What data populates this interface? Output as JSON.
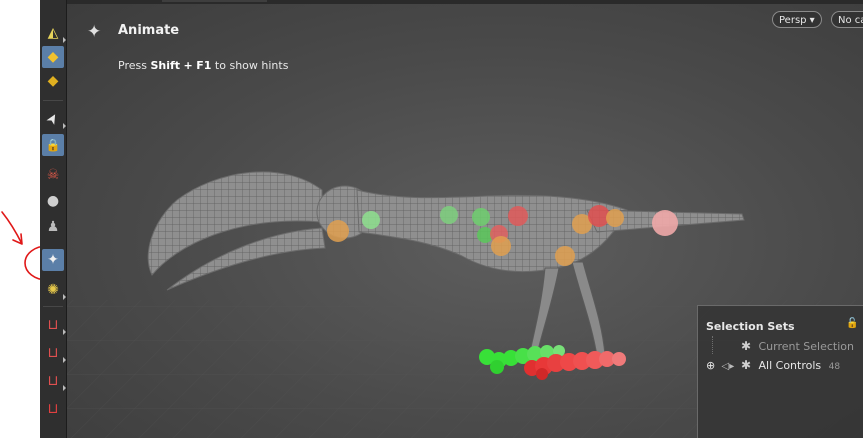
{
  "state": {
    "icon": "animate-puppet-icon",
    "title": "Animate",
    "hint_prefix": "Press",
    "hint_key1": "Shift",
    "hint_plus": "+",
    "hint_key2": "F1",
    "hint_suffix": "to show hints"
  },
  "camera": {
    "persp_label": "Persp ▾",
    "cam_label": "No ca"
  },
  "toolbar": {
    "tools": [
      {
        "icon": "paint-brush-icon",
        "glyph": "◭",
        "color": "#e6d35a"
      },
      {
        "icon": "select-box-icon",
        "glyph": "◆",
        "color": "#f2c22e"
      },
      {
        "icon": "move-box-icon",
        "glyph": "◆",
        "color": "#e0b020"
      },
      {
        "icon": "arrow-select-icon",
        "glyph": "➤",
        "color": "#e8e8e8"
      },
      {
        "icon": "lock-pose-icon",
        "glyph": "🔒",
        "color": "#ffffff"
      },
      {
        "icon": "pose-skull-icon",
        "glyph": "☠",
        "color": "#e05a4a"
      },
      {
        "icon": "bone-sphere-icon",
        "glyph": "●",
        "color": "#cfcfcf"
      },
      {
        "icon": "puppet-icon",
        "glyph": "♟",
        "color": "#bbbbbb"
      },
      {
        "icon": "animate-state-icon",
        "glyph": "✦",
        "color": "#f0f0f0"
      },
      {
        "icon": "capture-icon",
        "glyph": "✺",
        "color": "#e6c84a"
      },
      {
        "icon": "magnet-box-icon",
        "glyph": "⊔",
        "color": "#e05050"
      },
      {
        "icon": "magnet-curve-icon",
        "glyph": "⊔",
        "color": "#e05050"
      },
      {
        "icon": "magnet-dots-icon",
        "glyph": "⊔",
        "color": "#e05050"
      },
      {
        "icon": "magnet-icon",
        "glyph": "⊔",
        "color": "#e04040"
      }
    ]
  },
  "selection_sets": {
    "title": "Selection Sets",
    "current_label": "Current Selection",
    "all_label": "All Controls",
    "all_count": "48"
  },
  "colors": {
    "accent": "#5b7fa8",
    "annotation": "#e01818"
  }
}
